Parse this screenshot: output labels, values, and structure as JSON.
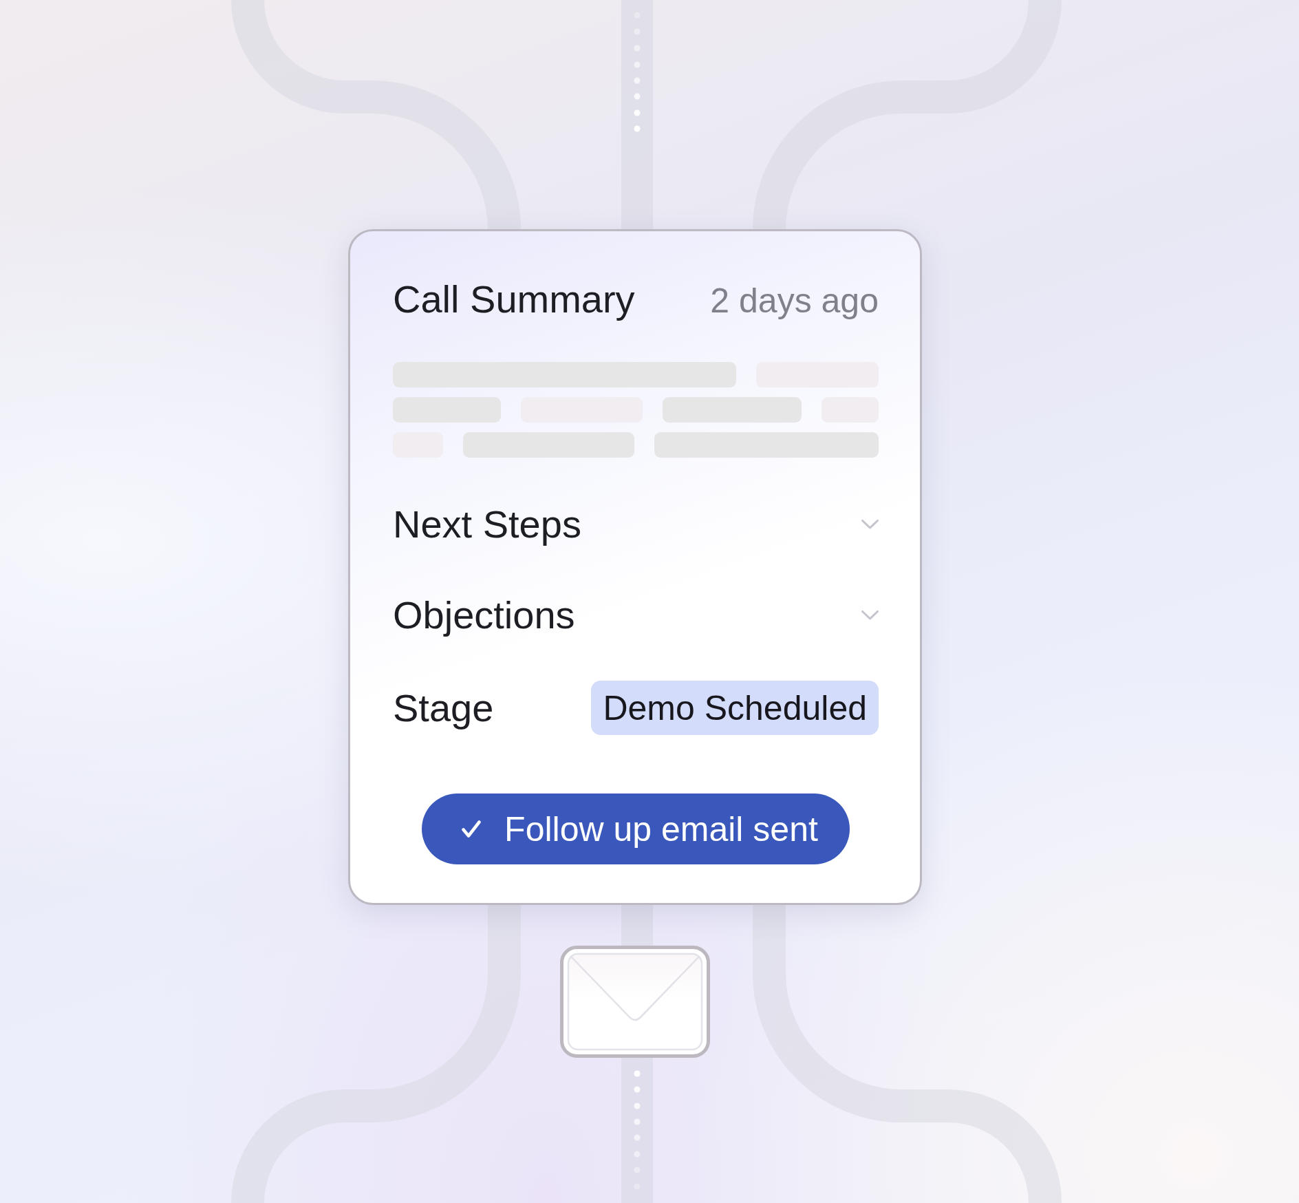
{
  "card": {
    "title": "Call Summary",
    "time": "2 days ago",
    "sections": [
      {
        "label": "Next Steps",
        "expanded": false
      },
      {
        "label": "Objections",
        "expanded": false
      }
    ],
    "stage": {
      "label": "Stage",
      "value": "Demo Scheduled"
    },
    "status_button": {
      "label": "Follow up email sent",
      "done": true
    }
  }
}
